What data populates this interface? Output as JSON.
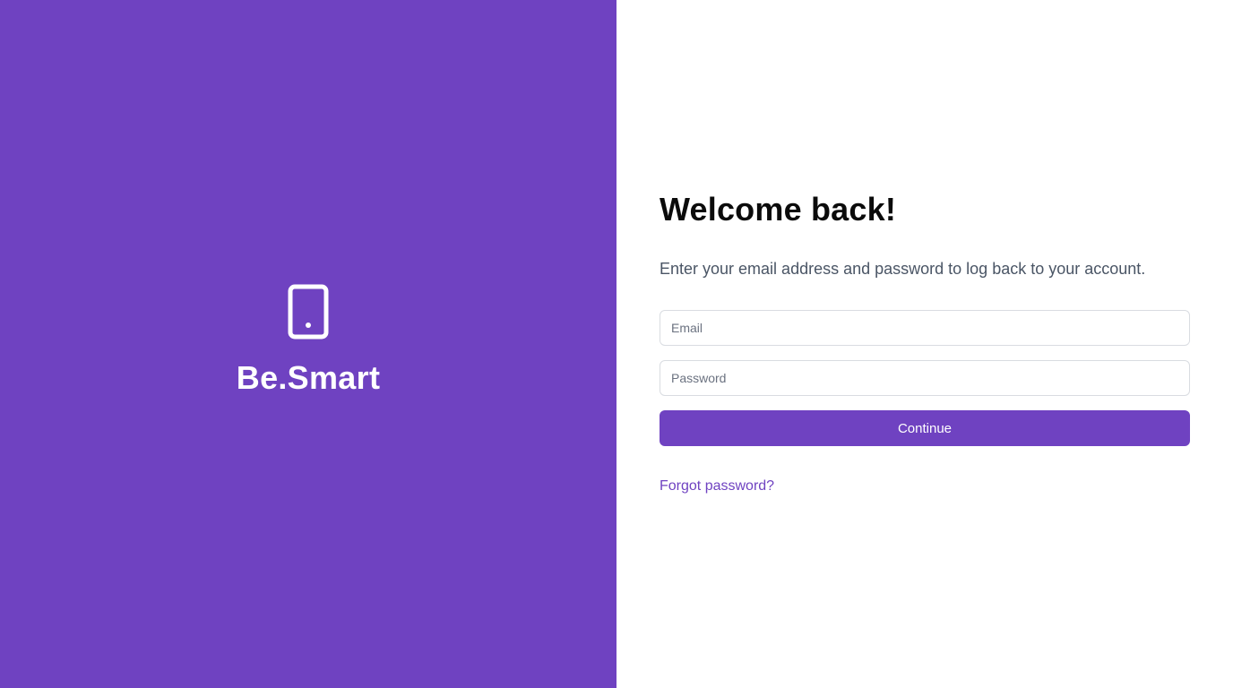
{
  "brand": {
    "name": "Be.Smart",
    "icon": "tablet-icon",
    "background_color": "#6f42c1"
  },
  "form": {
    "title": "Welcome back!",
    "subtitle": "Enter your email address and password to log back to your account.",
    "email_placeholder": "Email",
    "email_value": "",
    "password_placeholder": "Password",
    "password_value": "",
    "continue_label": "Continue",
    "forgot_label": "Forgot password?",
    "accent_color": "#6f42c1"
  }
}
